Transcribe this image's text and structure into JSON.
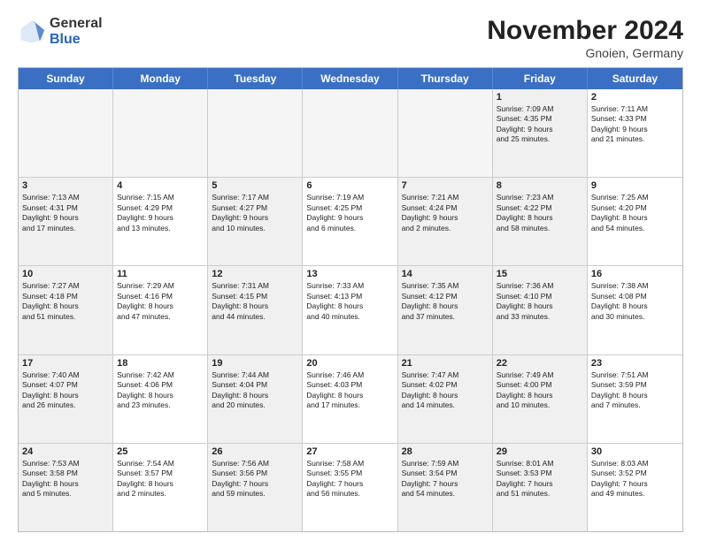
{
  "header": {
    "logo_general": "General",
    "logo_blue": "Blue",
    "month_title": "November 2024",
    "location": "Gnoien, Germany"
  },
  "weekdays": [
    "Sunday",
    "Monday",
    "Tuesday",
    "Wednesday",
    "Thursday",
    "Friday",
    "Saturday"
  ],
  "rows": [
    [
      {
        "day": "",
        "text": "",
        "empty": true
      },
      {
        "day": "",
        "text": "",
        "empty": true
      },
      {
        "day": "",
        "text": "",
        "empty": true
      },
      {
        "day": "",
        "text": "",
        "empty": true
      },
      {
        "day": "",
        "text": "",
        "empty": true
      },
      {
        "day": "1",
        "text": "Sunrise: 7:09 AM\nSunset: 4:35 PM\nDaylight: 9 hours\nand 25 minutes.",
        "shaded": true
      },
      {
        "day": "2",
        "text": "Sunrise: 7:11 AM\nSunset: 4:33 PM\nDaylight: 9 hours\nand 21 minutes."
      }
    ],
    [
      {
        "day": "3",
        "text": "Sunrise: 7:13 AM\nSunset: 4:31 PM\nDaylight: 9 hours\nand 17 minutes.",
        "shaded": true
      },
      {
        "day": "4",
        "text": "Sunrise: 7:15 AM\nSunset: 4:29 PM\nDaylight: 9 hours\nand 13 minutes."
      },
      {
        "day": "5",
        "text": "Sunrise: 7:17 AM\nSunset: 4:27 PM\nDaylight: 9 hours\nand 10 minutes.",
        "shaded": true
      },
      {
        "day": "6",
        "text": "Sunrise: 7:19 AM\nSunset: 4:25 PM\nDaylight: 9 hours\nand 6 minutes."
      },
      {
        "day": "7",
        "text": "Sunrise: 7:21 AM\nSunset: 4:24 PM\nDaylight: 9 hours\nand 2 minutes.",
        "shaded": true
      },
      {
        "day": "8",
        "text": "Sunrise: 7:23 AM\nSunset: 4:22 PM\nDaylight: 8 hours\nand 58 minutes.",
        "shaded": true
      },
      {
        "day": "9",
        "text": "Sunrise: 7:25 AM\nSunset: 4:20 PM\nDaylight: 8 hours\nand 54 minutes."
      }
    ],
    [
      {
        "day": "10",
        "text": "Sunrise: 7:27 AM\nSunset: 4:18 PM\nDaylight: 8 hours\nand 51 minutes.",
        "shaded": true
      },
      {
        "day": "11",
        "text": "Sunrise: 7:29 AM\nSunset: 4:16 PM\nDaylight: 8 hours\nand 47 minutes."
      },
      {
        "day": "12",
        "text": "Sunrise: 7:31 AM\nSunset: 4:15 PM\nDaylight: 8 hours\nand 44 minutes.",
        "shaded": true
      },
      {
        "day": "13",
        "text": "Sunrise: 7:33 AM\nSunset: 4:13 PM\nDaylight: 8 hours\nand 40 minutes."
      },
      {
        "day": "14",
        "text": "Sunrise: 7:35 AM\nSunset: 4:12 PM\nDaylight: 8 hours\nand 37 minutes.",
        "shaded": true
      },
      {
        "day": "15",
        "text": "Sunrise: 7:36 AM\nSunset: 4:10 PM\nDaylight: 8 hours\nand 33 minutes.",
        "shaded": true
      },
      {
        "day": "16",
        "text": "Sunrise: 7:38 AM\nSunset: 4:08 PM\nDaylight: 8 hours\nand 30 minutes."
      }
    ],
    [
      {
        "day": "17",
        "text": "Sunrise: 7:40 AM\nSunset: 4:07 PM\nDaylight: 8 hours\nand 26 minutes.",
        "shaded": true
      },
      {
        "day": "18",
        "text": "Sunrise: 7:42 AM\nSunset: 4:06 PM\nDaylight: 8 hours\nand 23 minutes."
      },
      {
        "day": "19",
        "text": "Sunrise: 7:44 AM\nSunset: 4:04 PM\nDaylight: 8 hours\nand 20 minutes.",
        "shaded": true
      },
      {
        "day": "20",
        "text": "Sunrise: 7:46 AM\nSunset: 4:03 PM\nDaylight: 8 hours\nand 17 minutes."
      },
      {
        "day": "21",
        "text": "Sunrise: 7:47 AM\nSunset: 4:02 PM\nDaylight: 8 hours\nand 14 minutes.",
        "shaded": true
      },
      {
        "day": "22",
        "text": "Sunrise: 7:49 AM\nSunset: 4:00 PM\nDaylight: 8 hours\nand 10 minutes.",
        "shaded": true
      },
      {
        "day": "23",
        "text": "Sunrise: 7:51 AM\nSunset: 3:59 PM\nDaylight: 8 hours\nand 7 minutes."
      }
    ],
    [
      {
        "day": "24",
        "text": "Sunrise: 7:53 AM\nSunset: 3:58 PM\nDaylight: 8 hours\nand 5 minutes.",
        "shaded": true
      },
      {
        "day": "25",
        "text": "Sunrise: 7:54 AM\nSunset: 3:57 PM\nDaylight: 8 hours\nand 2 minutes."
      },
      {
        "day": "26",
        "text": "Sunrise: 7:56 AM\nSunset: 3:56 PM\nDaylight: 7 hours\nand 59 minutes.",
        "shaded": true
      },
      {
        "day": "27",
        "text": "Sunrise: 7:58 AM\nSunset: 3:55 PM\nDaylight: 7 hours\nand 56 minutes."
      },
      {
        "day": "28",
        "text": "Sunrise: 7:59 AM\nSunset: 3:54 PM\nDaylight: 7 hours\nand 54 minutes.",
        "shaded": true
      },
      {
        "day": "29",
        "text": "Sunrise: 8:01 AM\nSunset: 3:53 PM\nDaylight: 7 hours\nand 51 minutes.",
        "shaded": true
      },
      {
        "day": "30",
        "text": "Sunrise: 8:03 AM\nSunset: 3:52 PM\nDaylight: 7 hours\nand 49 minutes."
      }
    ]
  ]
}
